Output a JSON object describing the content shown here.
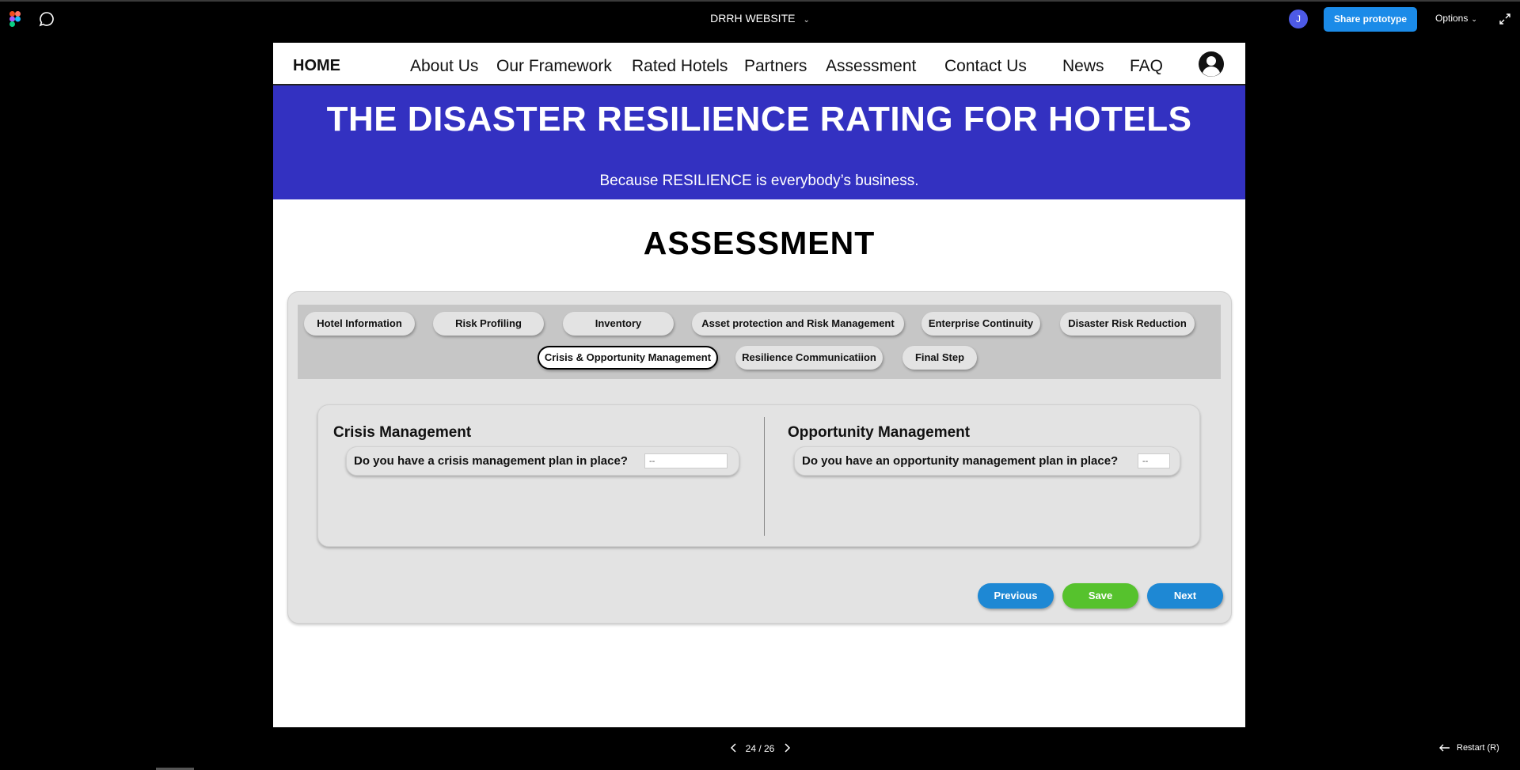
{
  "toolbar": {
    "file_title": "DRRH WEBSITE",
    "avatar_initial": "J",
    "share_label": "Share prototype",
    "options_label": "Options"
  },
  "nav": {
    "home": "HOME",
    "items": [
      "About Us",
      "Our Framework",
      "Rated Hotels",
      "Partners",
      "Assessment",
      "Contact Us",
      "News",
      "FAQ"
    ]
  },
  "hero": {
    "title": "THE DISASTER RESILIENCE RATING FOR HOTELS",
    "subtitle": "Because RESILIENCE is everybody’s business."
  },
  "page": {
    "heading": "ASSESSMENT"
  },
  "tabs": [
    "Hotel Information",
    "Risk Profiling",
    "Inventory",
    "Asset protection and Risk Management",
    "Enterprise Continuity",
    "Disaster Risk Reduction",
    "Crisis & Opportunity Management",
    "Resilience Communicatiion",
    "Final Step"
  ],
  "active_tab": "Crisis & Opportunity Management",
  "crisis": {
    "title": "Crisis Management",
    "question": "Do you have a crisis management plan in place?",
    "value": "--"
  },
  "opportunity": {
    "title": "Opportunity Management",
    "question": "Do you have an opportunity management plan in place?",
    "value": "--"
  },
  "buttons": {
    "previous": "Previous",
    "save": "Save",
    "next": "Next"
  },
  "colors": {
    "hero_bg": "#3331c1",
    "previous_bg": "#1e88d4",
    "save_bg": "#56c22d",
    "next_bg": "#1e88d4",
    "share_bg": "#1b8be8"
  },
  "footer": {
    "page_indicator": "24 / 26",
    "restart_label": "Restart (R)"
  }
}
